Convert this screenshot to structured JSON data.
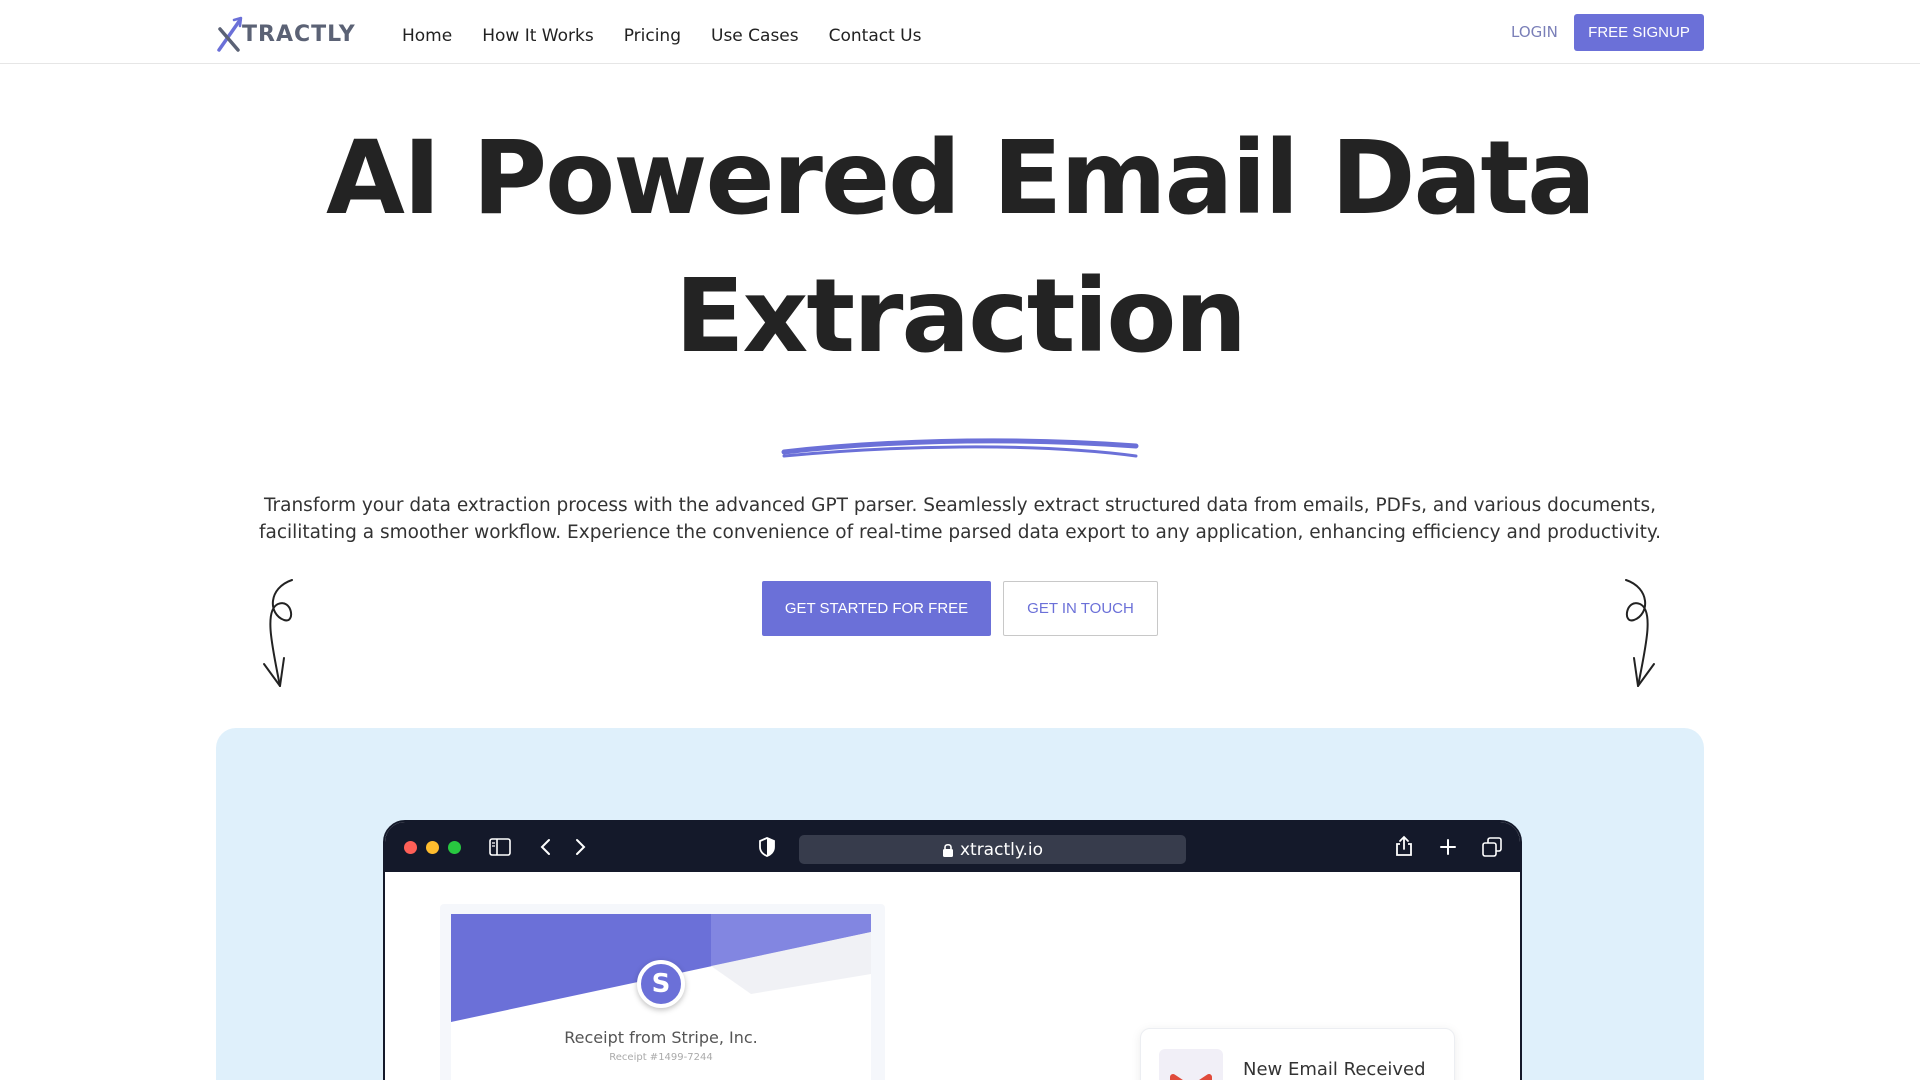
{
  "nav": {
    "logo_text": "TRACTLY",
    "links": [
      "Home",
      "How It Works",
      "Pricing",
      "Use Cases",
      "Contact Us"
    ],
    "login_label": "LOGIN",
    "signup_label": "FREE SIGNUP"
  },
  "hero": {
    "title_line1": "AI Powered Email Data",
    "title_line2": "Extraction",
    "description": "Transform your data extraction process with the advanced GPT parser. Seamlessly extract structured data from emails, PDFs, and various documents, facilitating a smoother workflow. Experience the convenience of real-time parsed data export to any application, enhancing efficiency and productivity.",
    "primary_cta": "GET STARTED FOR FREE",
    "secondary_cta": "GET IN TOUCH"
  },
  "browser": {
    "url": "xtractly.io",
    "icons": [
      "sidebar-icon",
      "back-icon",
      "forward-icon",
      "shield-icon",
      "lock-icon",
      "share-icon",
      "new-tab-icon",
      "tabs-icon"
    ]
  },
  "receipt": {
    "badge_letter": "S",
    "title": "Receipt from Stripe, Inc.",
    "subtitle": "Receipt #1499-7244"
  },
  "email_card": {
    "title": "New Email Received",
    "icon": "gmail-icon"
  },
  "colors": {
    "accent": "#6b70d8",
    "preview_bg": "#dff0fb",
    "browser_bar": "#14192a",
    "text": "#232323"
  }
}
